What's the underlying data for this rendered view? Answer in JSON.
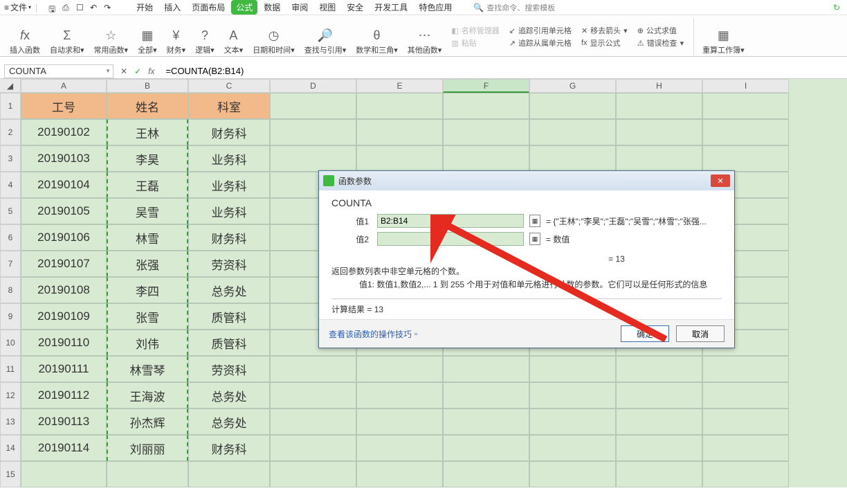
{
  "menu": {
    "file": "文件",
    "tabs": [
      "开始",
      "插入",
      "页面布局",
      "公式",
      "数据",
      "审阅",
      "视图",
      "安全",
      "开发工具",
      "特色应用"
    ],
    "active_index": 3,
    "search_placeholder": "查找命令、搜索模板"
  },
  "ribbon": {
    "g1": "插入函数",
    "g2": "自动求和",
    "g3": "常用函数",
    "g4": "全部",
    "g5": "财务",
    "g6": "逻辑",
    "g7": "文本",
    "g8": "日期和时间",
    "g9": "查找与引用",
    "g10": "数学和三角",
    "g11": "其他函数",
    "p1": "名称管理器",
    "p2": "粘贴",
    "r1": "追踪引用单元格",
    "r2": "追踪从属单元格",
    "r3": "移去箭头",
    "r4": "显示公式",
    "r5": "公式求值",
    "r6": "错误检查",
    "rg": "重算工作簿"
  },
  "formula_bar": {
    "name_box": "COUNTA",
    "formula": "=COUNTA(B2:B14)"
  },
  "columns": [
    "A",
    "B",
    "C",
    "D",
    "E",
    "F",
    "G",
    "H",
    "I"
  ],
  "sheet": {
    "headers": [
      "工号",
      "姓名",
      "科室"
    ],
    "rows": [
      {
        "a": "20190102",
        "b": "王林",
        "c": "财务科"
      },
      {
        "a": "20190103",
        "b": "李昊",
        "c": "业务科"
      },
      {
        "a": "20190104",
        "b": "王磊",
        "c": "业务科"
      },
      {
        "a": "20190105",
        "b": "吴雪",
        "c": "业务科"
      },
      {
        "a": "20190106",
        "b": "林雪",
        "c": "财务科"
      },
      {
        "a": "20190107",
        "b": "张强",
        "c": "劳资科"
      },
      {
        "a": "20190108",
        "b": "李四",
        "c": "总务处"
      },
      {
        "a": "20190109",
        "b": "张雪",
        "c": "质管科"
      },
      {
        "a": "20190110",
        "b": "刘伟",
        "c": "质管科"
      },
      {
        "a": "20190111",
        "b": "林雪琴",
        "c": "劳资科"
      },
      {
        "a": "20190112",
        "b": "王海波",
        "c": "总务处"
      },
      {
        "a": "20190113",
        "b": "孙杰辉",
        "c": "总务处"
      },
      {
        "a": "20190114",
        "b": "刘丽丽",
        "c": "财务科"
      }
    ]
  },
  "dialog": {
    "title": "函数参数",
    "func": "COUNTA",
    "arg1_label": "值1",
    "arg1_value": "B2:B14",
    "arg1_preview": "= {\"王林\";\"李昊\";\"王磊\";\"吴雪\";\"林雪\";\"张强...",
    "arg2_label": "值2",
    "arg2_preview": "= 数值",
    "result_eq": "= 13",
    "desc1": "返回参数列表中非空单元格的个数。",
    "desc2": "值1: 数值1,数值2,... 1 到 255 个用于对值和单元格进行计数的参数。它们可以是任何形式的信息",
    "calc_result_label": "计算结果 =",
    "calc_result": "13",
    "help": "查看该函数的操作技巧",
    "ok": "确定",
    "cancel": "取消"
  }
}
